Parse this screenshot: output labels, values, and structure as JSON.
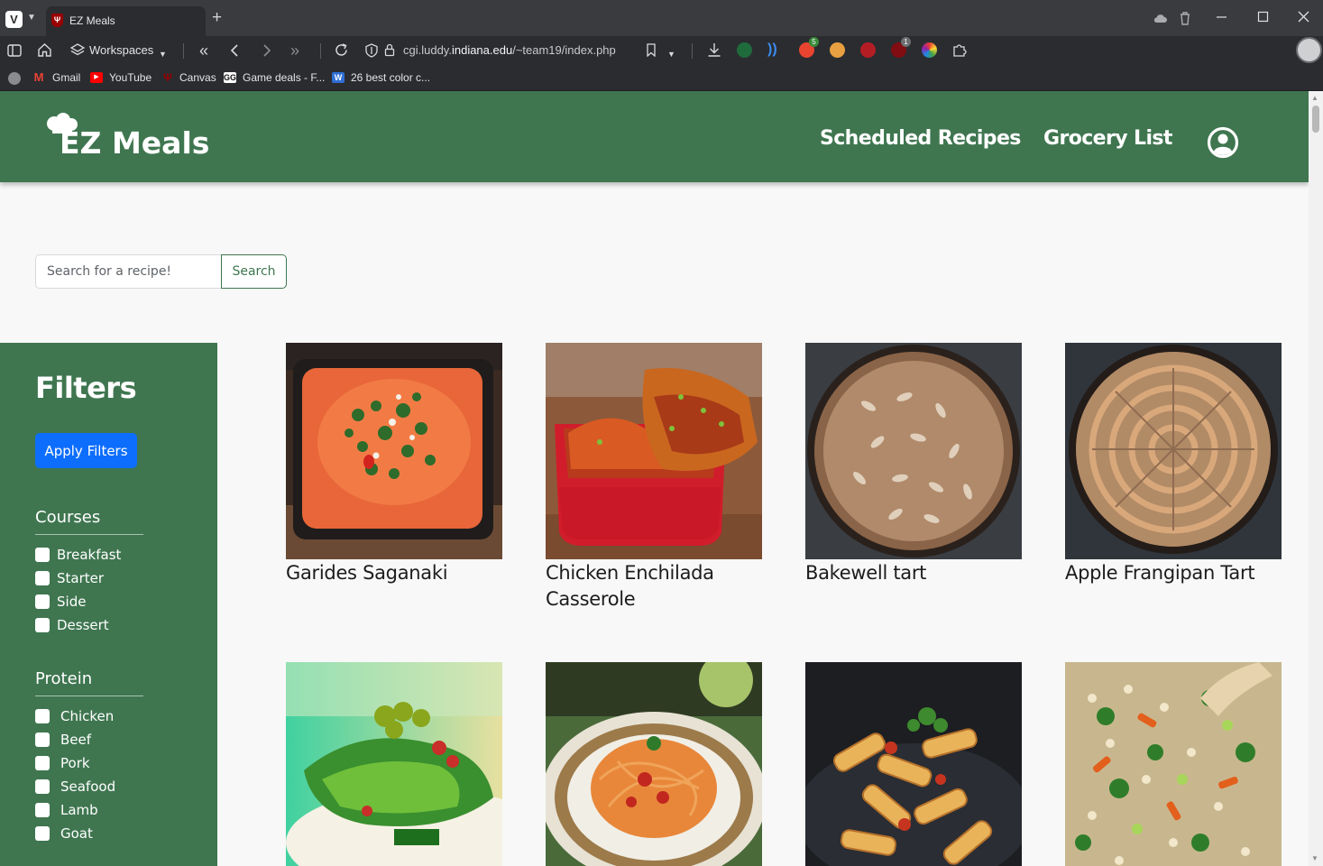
{
  "browser": {
    "tab_title": "EZ Meals",
    "new_tab_icon": "+",
    "workspaces_label": "Workspaces",
    "url_host_prefix": "cgi.luddy.",
    "url_host_main": "indiana.edu",
    "url_path": "/~team19/index.php",
    "extension_badges": {
      "first": "5",
      "second": "1"
    },
    "bookmarks": [
      "Gmail",
      "YouTube",
      "Canvas",
      "Game deals - F...",
      "26 best color c..."
    ]
  },
  "site": {
    "logo_text": "EZ Meals",
    "nav": {
      "scheduled": "Scheduled Recipes",
      "grocery": "Grocery List"
    },
    "brand_color": "#3f7650"
  },
  "search": {
    "placeholder": "Search for a recipe!",
    "value": "",
    "button_label": "Search"
  },
  "filters": {
    "title": "Filters",
    "apply_label": "Apply Filters",
    "courses": {
      "title": "Courses",
      "options": [
        "Breakfast",
        "Starter",
        "Side",
        "Dessert"
      ]
    },
    "protein": {
      "title": "Protein",
      "options": [
        "Chicken",
        "Beef",
        "Pork",
        "Seafood",
        "Lamb",
        "Goat"
      ]
    }
  },
  "recipes": [
    {
      "title": "Garides Saganaki"
    },
    {
      "title": "Chicken Enchilada Casserole"
    },
    {
      "title": "Bakewell tart"
    },
    {
      "title": "Apple Frangipan Tart"
    },
    {
      "title": ""
    },
    {
      "title": ""
    },
    {
      "title": ""
    },
    {
      "title": ""
    }
  ]
}
